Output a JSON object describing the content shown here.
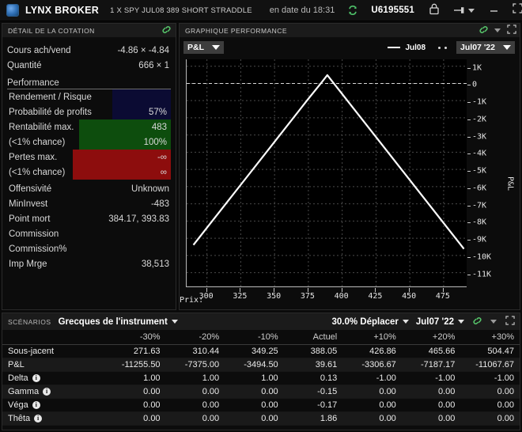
{
  "titlebar": {
    "logo": "globe-icon",
    "brand": "LYNX BROKER",
    "contract": "1 X SPY JUL08 389 SHORT STRADDLE",
    "as_of": "en date du 18:31",
    "refresh_icon": "refresh-icon",
    "account": "U6195551",
    "lock_icon": "lock-icon",
    "pin_icon": "pin-icon",
    "minimize": "minimize-icon",
    "maximize": "maximize-icon",
    "close": "close-icon"
  },
  "quote_panel": {
    "title": "Détail de la cotation",
    "link_icon": "link-icon",
    "rows": [
      {
        "label": "Cours ach/vend",
        "value": "-4.86 × -4.84"
      },
      {
        "label": "Quantité",
        "value": "666 × 1"
      }
    ],
    "section": "Performance",
    "metrics": [
      {
        "label": "Rendement / Risque",
        "value": "",
        "fill": "navy"
      },
      {
        "label": "Probabilité de profits",
        "value": "57%",
        "fill": "navy"
      },
      {
        "label": "Rentabilité max.",
        "value": "483",
        "fill": "green"
      },
      {
        "label": "(<1% chance)",
        "value": "100%",
        "fill": "green"
      },
      {
        "label": "Pertes max.",
        "value": "-∞",
        "fill": "red"
      },
      {
        "label": "(<1% chance)",
        "value": "∞",
        "fill": "red"
      }
    ],
    "plain": [
      {
        "label": "Offensivité",
        "value": "Unknown"
      },
      {
        "label": "MinInvest",
        "value": "-483"
      },
      {
        "label": "Point mort",
        "value": "384.17, 393.83"
      },
      {
        "label": "Commission",
        "value": ""
      },
      {
        "label": "Commission%",
        "value": ""
      },
      {
        "label": "Imp Mrge",
        "value": "38,513"
      }
    ],
    "colors": {
      "navy": "#0b0b33",
      "green": "#0d4d0d",
      "red": "#8d0d0d",
      "link": "#56c46a"
    }
  },
  "chart_panel": {
    "title": "Graphique performance",
    "link_icon": "link-icon",
    "caret_icon": "chevron-down-icon",
    "expand_icon": "expand-icon",
    "metric_select": "P&L",
    "legend_line_label": "Jul08",
    "legend_dots_label": "",
    "date_select": "Jul07 '22"
  },
  "chart_data": {
    "type": "line",
    "title": "P&L",
    "xlabel": "Prix:",
    "ylabel": "P&L",
    "xlim": [
      285,
      492
    ],
    "ylim": [
      -11800,
      1400
    ],
    "xticks": [
      300,
      325,
      350,
      375,
      400,
      425,
      450,
      475
    ],
    "yticks": [
      1000,
      0,
      -1000,
      -2000,
      -3000,
      -4000,
      -5000,
      -6000,
      -7000,
      -8000,
      -9000,
      -10000,
      -11000
    ],
    "yticklabels": [
      "1K",
      "0",
      "-1K",
      "-2K",
      "-3K",
      "-4K",
      "-5K",
      "-6K",
      "-7K",
      "-8K",
      "-9K",
      "-10K",
      "-11K"
    ],
    "grid": true,
    "zero_line": 0,
    "series": [
      {
        "name": "Jul08",
        "color": "#ffffff",
        "x": [
          290,
          300,
          325,
          350,
          375,
          384.17,
          389,
          393.83,
          400,
          425,
          450,
          475,
          490
        ],
        "y": [
          -9390,
          -8390,
          -5890,
          -3390,
          -890,
          0,
          483,
          0,
          -617,
          -3117,
          -5617,
          -8117,
          -9617
        ]
      }
    ]
  },
  "scenarios": {
    "tag": "Scénarios",
    "selector": "Grecques de l'instrument",
    "move_label": "30.0% Déplacer",
    "date_select": "Jul07 '22",
    "link_icon": "link-icon",
    "caret_icon": "chevron-down-icon",
    "expand_icon": "expand-icon",
    "columns": [
      "",
      "-30%",
      "-20%",
      "-10%",
      "Actuel",
      "+10%",
      "+20%",
      "+30%"
    ],
    "rows": [
      {
        "label": "Sous-jacent",
        "info": false,
        "values": [
          "271.63",
          "310.44",
          "349.25",
          "388.05",
          "426.86",
          "465.66",
          "504.47"
        ]
      },
      {
        "label": "P&L",
        "info": false,
        "values": [
          "-11255.50",
          "-7375.00",
          "-3494.50",
          "39.61",
          "-3306.67",
          "-7187.17",
          "-11067.67"
        ]
      },
      {
        "label": "Delta",
        "info": true,
        "values": [
          "1.00",
          "1.00",
          "1.00",
          "0.13",
          "-1.00",
          "-1.00",
          "-1.00"
        ]
      },
      {
        "label": "Gamma",
        "info": true,
        "values": [
          "0.00",
          "0.00",
          "0.00",
          "-0.15",
          "0.00",
          "0.00",
          "0.00"
        ]
      },
      {
        "label": "Véga",
        "info": true,
        "values": [
          "0.00",
          "0.00",
          "0.00",
          "-0.17",
          "0.00",
          "0.00",
          "0.00"
        ]
      },
      {
        "label": "Thêta",
        "info": true,
        "values": [
          "0.00",
          "0.00",
          "0.00",
          "1.86",
          "0.00",
          "0.00",
          "0.00"
        ]
      }
    ]
  }
}
